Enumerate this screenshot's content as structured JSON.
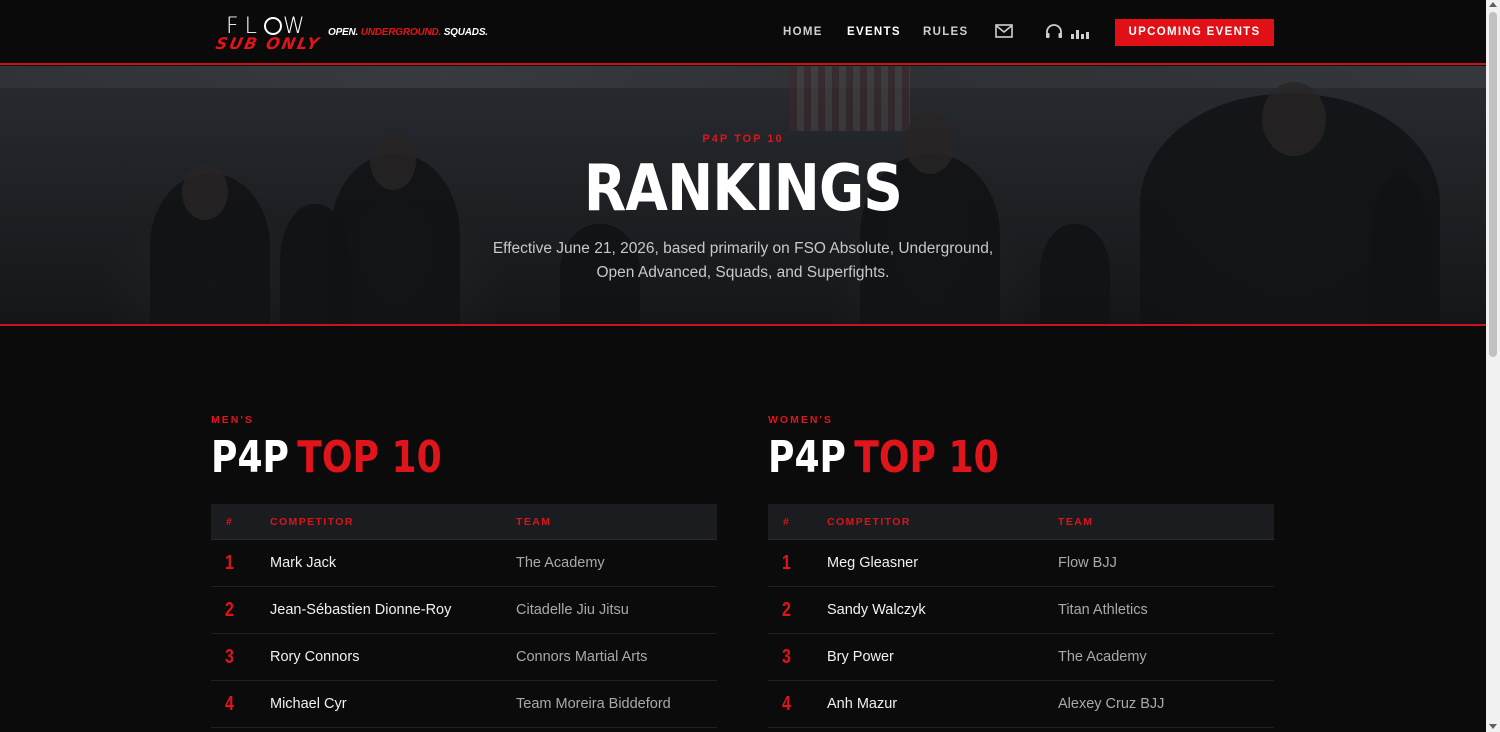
{
  "header": {
    "logo_top": "FLOW",
    "logo_bottom": "SUB ONLY",
    "tagline_open": "OPEN.",
    "tagline_underground": "UNDERGROUND.",
    "tagline_squads": "SQUADS.",
    "nav": [
      {
        "label": "HOME",
        "active": false
      },
      {
        "label": "EVENTS",
        "active": true
      },
      {
        "label": "RULES",
        "active": false
      }
    ],
    "icons": [
      "mail-icon",
      "headphones-icon",
      "bars-icon"
    ],
    "cta_label": "UPCOMING EVENTS"
  },
  "hero": {
    "eyebrow": "P4P TOP 10",
    "title": "RANKINGS",
    "subtitle_line1": "Effective June 21, 2026, based primarily on FSO Absolute, Underground,",
    "subtitle_line2": "Open Advanced, Squads, and Superfights."
  },
  "mens": {
    "eyebrow": "MEN'S",
    "title_white": "P4P",
    "title_red": "TOP 10",
    "columns": {
      "rank": "#",
      "competitor": "COMPETITOR",
      "team": "TEAM"
    },
    "rows": [
      {
        "rank": "1",
        "name": "Mark Jack",
        "team": "The Academy"
      },
      {
        "rank": "2",
        "name": "Jean-Sébastien Dionne-Roy",
        "team": "Citadelle Jiu Jitsu"
      },
      {
        "rank": "3",
        "name": "Rory Connors",
        "team": "Connors Martial Arts"
      },
      {
        "rank": "4",
        "name": "Michael Cyr",
        "team": "Team Moreira Biddeford"
      }
    ]
  },
  "womens": {
    "eyebrow": "WOMEN'S",
    "title_white": "P4P",
    "title_red": "TOP 10",
    "columns": {
      "rank": "#",
      "competitor": "COMPETITOR",
      "team": "TEAM"
    },
    "rows": [
      {
        "rank": "1",
        "name": "Meg Gleasner",
        "team": "Flow BJJ"
      },
      {
        "rank": "2",
        "name": "Sandy Walczyk",
        "team": "Titan Athletics"
      },
      {
        "rank": "3",
        "name": "Bry Power",
        "team": "The Academy"
      },
      {
        "rank": "4",
        "name": "Anh Mazur",
        "team": "Alexey Cruz BJJ"
      }
    ]
  },
  "colors": {
    "accent": "#e10f16",
    "background": "#0b0b0c",
    "table_header": "#1b1c1f"
  }
}
